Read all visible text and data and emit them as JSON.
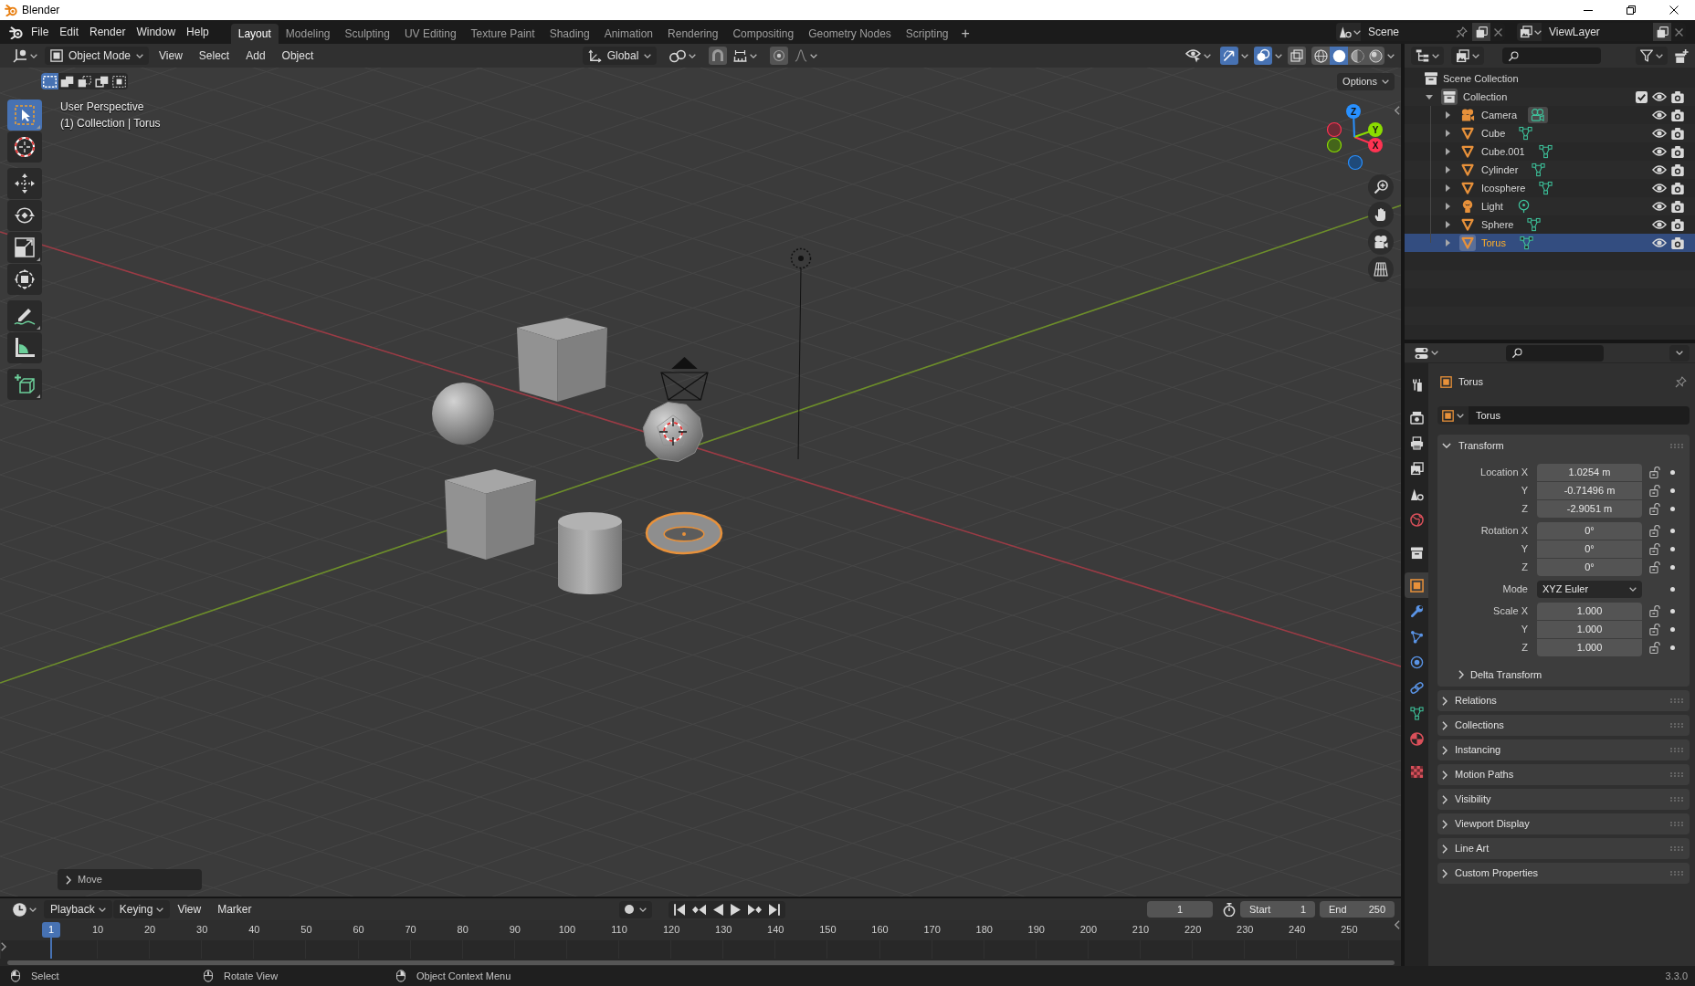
{
  "window": {
    "title": "Blender"
  },
  "menu_bar": {
    "items": [
      "File",
      "Edit",
      "Render",
      "Window",
      "Help"
    ]
  },
  "workspace_tabs": [
    {
      "label": "Layout",
      "selected": true
    },
    {
      "label": "Modeling",
      "selected": false
    },
    {
      "label": "Sculpting",
      "selected": false
    },
    {
      "label": "UV Editing",
      "selected": false
    },
    {
      "label": "Texture Paint",
      "selected": false
    },
    {
      "label": "Shading",
      "selected": false
    },
    {
      "label": "Animation",
      "selected": false
    },
    {
      "label": "Rendering",
      "selected": false
    },
    {
      "label": "Compositing",
      "selected": false
    },
    {
      "label": "Geometry Nodes",
      "selected": false
    },
    {
      "label": "Scripting",
      "selected": false
    }
  ],
  "add_workspace": "+",
  "scene": {
    "value": "Scene"
  },
  "view_layer": {
    "value": "ViewLayer"
  },
  "viewport": {
    "header": {
      "mode": "Object Mode",
      "menus": [
        "View",
        "Select",
        "Add",
        "Object"
      ],
      "orientation": "Global",
      "toggles": [
        {
          "kind": "gizmo",
          "on": true
        },
        {
          "kind": "overlay",
          "on": true
        },
        {
          "kind": "xray",
          "on": false
        }
      ],
      "shading": [
        {
          "kind": "wireframe",
          "selected": false
        },
        {
          "kind": "solid",
          "selected": true
        },
        {
          "kind": "material",
          "selected": false
        },
        {
          "kind": "rendered",
          "selected": false
        }
      ],
      "options": "Options"
    },
    "select_modes": [
      {
        "kind": "set",
        "selected": true
      },
      {
        "kind": "extend",
        "selected": false
      },
      {
        "kind": "subtract",
        "selected": false
      },
      {
        "kind": "invert",
        "selected": false
      },
      {
        "kind": "intersect",
        "selected": false
      }
    ],
    "tool_groups": [
      [
        {
          "kind": "select",
          "selected": true
        },
        {
          "kind": "cursor",
          "selected": false
        }
      ],
      [
        {
          "kind": "move",
          "selected": false
        },
        {
          "kind": "rotate",
          "selected": false
        },
        {
          "kind": "scale",
          "selected": false
        },
        {
          "kind": "transform",
          "selected": false
        }
      ],
      [
        {
          "kind": "annotate",
          "selected": false
        },
        {
          "kind": "measure",
          "selected": false
        }
      ],
      [
        {
          "kind": "add_cube",
          "selected": false
        }
      ]
    ],
    "info": [
      "User Perspective",
      "(1) Collection | Torus"
    ],
    "navigation_gizmo": {
      "axes": [
        "X",
        "Y",
        "Z"
      ]
    },
    "objects": [
      {
        "kind": "light",
        "selected": false
      },
      {
        "kind": "cube",
        "selected": false
      },
      {
        "kind": "camera",
        "selected": false
      },
      {
        "kind": "uv_sphere",
        "selected": false
      },
      {
        "kind": "icosphere",
        "selected": false
      },
      {
        "kind": "cube",
        "selected": false
      },
      {
        "kind": "cylinder",
        "selected": false
      },
      {
        "kind": "torus",
        "selected": true
      }
    ],
    "last_operator": "Move"
  },
  "outliner": {
    "root": "Scene Collection",
    "collections": [
      {
        "name": "Collection",
        "expanded": true,
        "active": true,
        "checked": true,
        "visible": true,
        "renderable": true,
        "children": [
          {
            "name": "Camera",
            "kind": "camera",
            "expanded": false,
            "selected": false,
            "data_active": true,
            "visible": true,
            "renderable": true
          },
          {
            "name": "Cube",
            "kind": "mesh",
            "expanded": false,
            "selected": false,
            "data_active": false,
            "visible": true,
            "renderable": true
          },
          {
            "name": "Cube.001",
            "kind": "mesh",
            "expanded": false,
            "selected": false,
            "data_active": false,
            "visible": true,
            "renderable": true
          },
          {
            "name": "Cylinder",
            "kind": "mesh",
            "expanded": false,
            "selected": false,
            "data_active": false,
            "visible": true,
            "renderable": true
          },
          {
            "name": "Icosphere",
            "kind": "mesh",
            "expanded": false,
            "selected": false,
            "data_active": false,
            "visible": true,
            "renderable": true
          },
          {
            "name": "Light",
            "kind": "light",
            "expanded": false,
            "selected": false,
            "data_active": false,
            "visible": true,
            "renderable": true
          },
          {
            "name": "Sphere",
            "kind": "mesh",
            "expanded": false,
            "selected": false,
            "data_active": false,
            "visible": true,
            "renderable": true
          },
          {
            "name": "Torus",
            "kind": "mesh",
            "expanded": false,
            "selected": true,
            "data_active": false,
            "visible": true,
            "renderable": true
          }
        ]
      }
    ]
  },
  "properties": {
    "tab_groups": [
      [
        {
          "kind": "tool",
          "selected": false
        }
      ],
      [
        {
          "kind": "render",
          "selected": false
        },
        {
          "kind": "output",
          "selected": false
        },
        {
          "kind": "view_layer",
          "selected": false
        },
        {
          "kind": "scene",
          "selected": false
        },
        {
          "kind": "world",
          "selected": false
        }
      ],
      [
        {
          "kind": "collection",
          "selected": false
        }
      ],
      [
        {
          "kind": "object",
          "selected": true
        },
        {
          "kind": "modifiers",
          "selected": false
        },
        {
          "kind": "particles",
          "selected": false
        },
        {
          "kind": "physics",
          "selected": false
        },
        {
          "kind": "constraints",
          "selected": false
        },
        {
          "kind": "data",
          "selected": false
        },
        {
          "kind": "material",
          "selected": false
        }
      ],
      [
        {
          "kind": "texture",
          "selected": false
        }
      ]
    ],
    "context": "Torus",
    "name": "Torus",
    "transform": {
      "title": "Transform",
      "expanded": true,
      "location": [
        {
          "label": "Location X",
          "value": "1.0254 m",
          "locked": false
        },
        {
          "label": "Y",
          "value": "-0.71496 m",
          "locked": false
        },
        {
          "label": "Z",
          "value": "-2.9051 m",
          "locked": false
        }
      ],
      "rotation": [
        {
          "label": "Rotation X",
          "value": "0°",
          "locked": false
        },
        {
          "label": "Y",
          "value": "0°",
          "locked": false
        },
        {
          "label": "Z",
          "value": "0°",
          "locked": false
        }
      ],
      "mode": {
        "label": "Mode",
        "value": "XYZ Euler"
      },
      "scale": [
        {
          "label": "Scale X",
          "value": "1.000",
          "locked": false
        },
        {
          "label": "Y",
          "value": "1.000",
          "locked": false
        },
        {
          "label": "Z",
          "value": "1.000",
          "locked": false
        }
      ],
      "subpanels": [
        {
          "title": "Delta Transform",
          "expanded": false
        }
      ]
    },
    "panels": [
      {
        "title": "Relations",
        "expanded": false
      },
      {
        "title": "Collections",
        "expanded": false
      },
      {
        "title": "Instancing",
        "expanded": false
      },
      {
        "title": "Motion Paths",
        "expanded": false
      },
      {
        "title": "Visibility",
        "expanded": false
      },
      {
        "title": "Viewport Display",
        "expanded": false
      },
      {
        "title": "Line Art",
        "expanded": false
      },
      {
        "title": "Custom Properties",
        "expanded": false
      }
    ]
  },
  "timeline": {
    "menus": [
      {
        "label": "Playback",
        "kind": "dropdown"
      },
      {
        "label": "Keying",
        "kind": "dropdown"
      },
      {
        "label": "View",
        "kind": "menu"
      },
      {
        "label": "Marker",
        "kind": "menu"
      }
    ],
    "auto_keying": false,
    "frame": "1",
    "start": {
      "label": "Start",
      "value": "1"
    },
    "end": {
      "label": "End",
      "value": "250"
    },
    "playhead": "1",
    "ruler": [
      "10",
      "20",
      "30",
      "40",
      "50",
      "60",
      "70",
      "80",
      "90",
      "100",
      "110",
      "120",
      "130",
      "140",
      "150",
      "160",
      "170",
      "180",
      "190",
      "200",
      "210",
      "220",
      "230",
      "240",
      "250"
    ]
  },
  "status_bar": {
    "hints": [
      {
        "kind": "left_click",
        "text": "Select"
      },
      {
        "kind": "middle_click",
        "text": "Rotate View"
      },
      {
        "kind": "right_click",
        "text": "Object Context Menu"
      }
    ],
    "version": "3.3.0"
  }
}
